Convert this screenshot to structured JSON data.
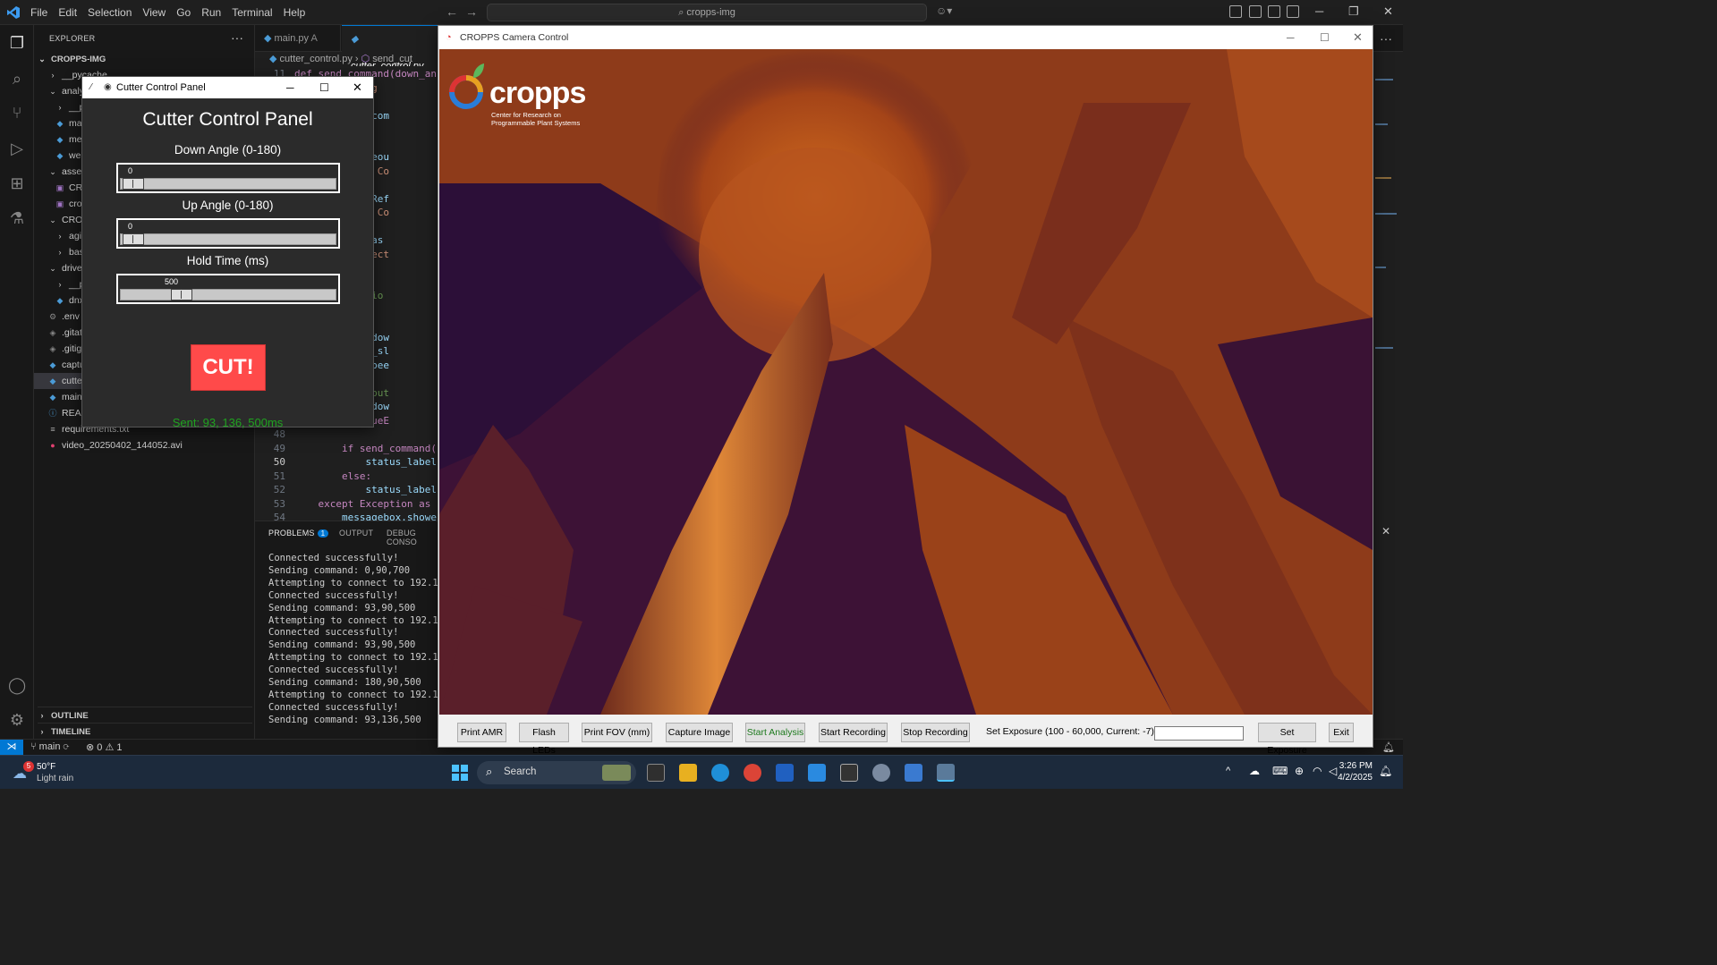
{
  "vscode": {
    "menu": [
      "File",
      "Edit",
      "Selection",
      "View",
      "Go",
      "Run",
      "Terminal",
      "Help"
    ],
    "command_center": "cropps-img",
    "explorer_header": "EXPLORER",
    "root": "CROPPS-IMG",
    "tree": [
      {
        "label": "__pycache__",
        "icon": "chevron-right"
      },
      {
        "label": "analy",
        "icon": "chevron-down"
      },
      {
        "label": "__py",
        "icon": "chevron-right"
      },
      {
        "label": "mai",
        "icon": "py"
      },
      {
        "label": "mes",
        "icon": "py"
      },
      {
        "label": "web",
        "icon": "py"
      },
      {
        "label": "asset",
        "icon": "chevron-down"
      },
      {
        "label": "CRO",
        "icon": "image"
      },
      {
        "label": "crop",
        "icon": "image"
      },
      {
        "label": "CROP",
        "icon": "chevron-down"
      },
      {
        "label": "agit",
        "icon": "chevron-right"
      },
      {
        "label": "basi",
        "icon": "chevron-right"
      },
      {
        "label": "drive",
        "icon": "chevron-down"
      },
      {
        "label": "__py",
        "icon": "chevron-right"
      },
      {
        "label": "dnx",
        "icon": "py"
      },
      {
        "label": ".env",
        "icon": "gear"
      },
      {
        "label": ".gitat",
        "icon": "git"
      },
      {
        "label": ".gitig",
        "icon": "git"
      },
      {
        "label": "captu",
        "icon": "py"
      },
      {
        "label": "cutte",
        "icon": "py"
      },
      {
        "label": "main.",
        "icon": "py"
      },
      {
        "label": "READ",
        "icon": "info"
      },
      {
        "label": "requirements.txt",
        "icon": "lines"
      },
      {
        "label": "video_20250402_144052.avi",
        "icon": "video"
      }
    ],
    "outline": "OUTLINE",
    "timeline": "TIMELINE",
    "tabs": [
      {
        "label": "main.py",
        "suffix": "A"
      },
      {
        "label": "cutter_control.py",
        "suffix": ""
      }
    ],
    "breadcrumb": [
      "cutter_control.py",
      "send_cut"
    ],
    "code": [
      {
        "ln": "11",
        "text": "def send_command(down_an"
      },
      {
        "ln": "",
        "text": "    (f\"Sending"
      },
      {
        "ln": "",
        "text": ""
      },
      {
        "ln": "",
        "text": "    .sendall(com"
      },
      {
        "ln": "",
        "text": "    .close()"
      },
      {
        "ln": "",
        "text": "    rn True"
      },
      {
        "ln": "",
        "text": "    ocket.timeou"
      },
      {
        "ln": "",
        "text": "    t(\"Error: Co"
      },
      {
        "ln": "",
        "text": "    rn False"
      },
      {
        "ln": "",
        "text": "    onnectionRef"
      },
      {
        "ln": "",
        "text": "    t(\"Error: Co"
      },
      {
        "ln": "",
        "text": "    rn False"
      },
      {
        "ln": "",
        "text": "    xception as"
      },
      {
        "ln": "",
        "text": "    t(f\"Unexpect"
      },
      {
        "ln": "",
        "text": "    rn False"
      },
      {
        "ln": "",
        "text": ""
      },
      {
        "ln": "",
        "text": "    GUI Functio"
      },
      {
        "ln": "",
        "text": "    ():"
      },
      {
        "ln": "",
        "text": ""
      },
      {
        "ln": "",
        "text": "    _angle = dow"
      },
      {
        "ln": "",
        "text": "    ngle = up_sl"
      },
      {
        "ln": "",
        "text": "    _time = spee"
      },
      {
        "ln": "",
        "text": ""
      },
      {
        "ln": "",
        "text": "    lidate input"
      },
      {
        "ln": "",
        "text": "    ot (0 <= dow"
      },
      {
        "ln": "",
        "text": "    raise ValueE"
      },
      {
        "ln": "48",
        "text": ""
      },
      {
        "ln": "49",
        "text": "        if send_command("
      },
      {
        "ln": "50",
        "text": "            status_label"
      },
      {
        "ln": "51",
        "text": "        else:"
      },
      {
        "ln": "52",
        "text": "            status_label"
      },
      {
        "ln": "53",
        "text": "    except Exception as"
      },
      {
        "ln": "54",
        "text": "        messagebox.showe"
      }
    ],
    "panel_tabs": [
      "PROBLEMS",
      "OUTPUT",
      "DEBUG CONSO"
    ],
    "problems_count": "1",
    "terminal": [
      "Connected successfully!",
      "Sending command: 0,90,700",
      "Attempting to connect to 192.168.",
      "Connected successfully!",
      "Sending command: 93,90,500",
      "Attempting to connect to 192.168.",
      "Connected successfully!",
      "Sending command: 93,90,500",
      "Attempting to connect to 192.168.",
      "Connected successfully!",
      "Sending command: 180,90,500",
      "Attempting to connect to 192.168.",
      "Connected successfully!",
      "Sending command: 93,136,500"
    ],
    "status": {
      "branch": "main",
      "errors": "0",
      "warnings": "1"
    }
  },
  "cutter": {
    "window_title": "Cutter Control Panel",
    "heading": "Cutter Control Panel",
    "sliders": [
      {
        "label": "Down Angle (0-180)",
        "value": "0",
        "fraction": 0.0
      },
      {
        "label": "Up Angle (0-180)",
        "value": "0",
        "fraction": 0.0
      },
      {
        "label": "Hold Time (ms)",
        "value": "500",
        "fraction": 0.25
      }
    ],
    "cut_label": "CUT!",
    "status": "Sent: 93, 136, 500ms"
  },
  "camera": {
    "window_title": "CROPPS Camera Control",
    "logo_text": "cropps",
    "logo_sub1": "Center for Research on",
    "logo_sub2": "Programmable Plant Systems",
    "buttons": [
      "Print AMR",
      "Flash LEDs",
      "Print FOV (mm)",
      "Capture Image",
      "Start Analysis",
      "Start Recording",
      "Stop Recording"
    ],
    "exposure_label": "Set Exposure (100 - 60,000, Current: -7):",
    "exposure_value": "",
    "set_exposure": "Set Exposure",
    "exit": "Exit"
  },
  "taskbar": {
    "weather_temp": "50°F",
    "weather_desc": "Light rain",
    "weather_badge": "5",
    "search": "Search",
    "time": "3:26 PM",
    "date": "4/2/2025"
  },
  "colors": {
    "accent": "#0078d4",
    "cut": "#ff4a4a",
    "status_green": "#1fa31f"
  }
}
